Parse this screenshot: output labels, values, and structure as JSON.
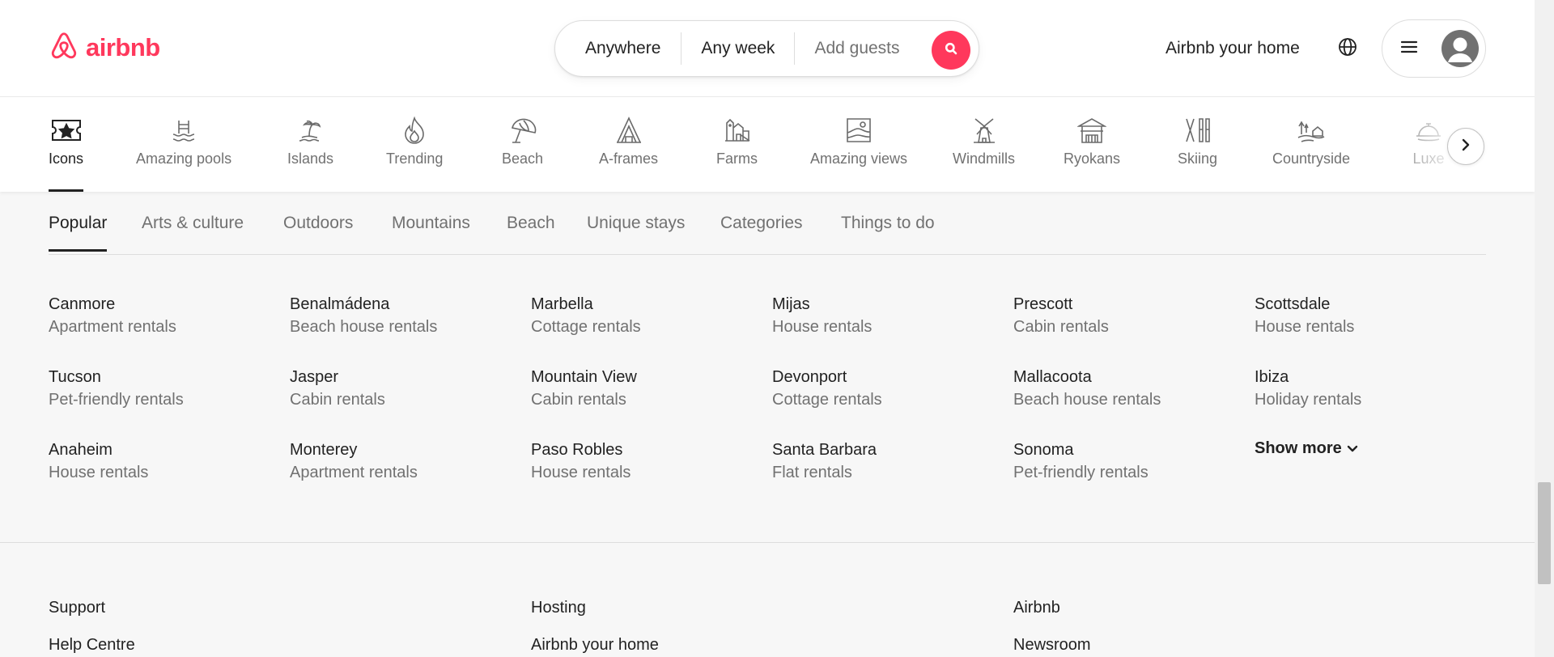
{
  "brand": {
    "name": "airbnb",
    "color": "#ff385c",
    "logo_icon": "airbnb-belo-icon"
  },
  "search": {
    "where": "Anywhere",
    "when": "Any week",
    "guests": "Add guests",
    "button_icon": "search-icon"
  },
  "header": {
    "host_link": "Airbnb your home",
    "globe_icon": "globe-icon",
    "menu_icon": "hamburger-menu-icon",
    "avatar_icon": "user-avatar-icon"
  },
  "categories": {
    "items": [
      {
        "label": "Icons",
        "icon": "ticket-star-icon",
        "active": true
      },
      {
        "label": "Amazing pools",
        "icon": "pool-icon"
      },
      {
        "label": "Islands",
        "icon": "island-palm-icon"
      },
      {
        "label": "Trending",
        "icon": "flame-icon"
      },
      {
        "label": "Beach",
        "icon": "beach-umbrella-icon"
      },
      {
        "label": "A-frames",
        "icon": "a-frame-icon"
      },
      {
        "label": "Farms",
        "icon": "barn-icon"
      },
      {
        "label": "Amazing views",
        "icon": "picture-view-icon"
      },
      {
        "label": "Windmills",
        "icon": "windmill-icon"
      },
      {
        "label": "Ryokans",
        "icon": "ryokan-icon"
      },
      {
        "label": "Skiing",
        "icon": "skis-icon"
      },
      {
        "label": "Countryside",
        "icon": "countryside-icon"
      },
      {
        "label": "Luxe",
        "icon": "luxe-cloche-icon"
      }
    ],
    "next_icon": "chevron-right-icon"
  },
  "tabs": [
    "Popular",
    "Arts & culture",
    "Outdoors",
    "Mountains",
    "Beach",
    "Unique stays",
    "Categories",
    "Things to do"
  ],
  "destinations": [
    {
      "city": "Canmore",
      "type": "Apartment rentals"
    },
    {
      "city": "Benalmádena",
      "type": "Beach house rentals"
    },
    {
      "city": "Marbella",
      "type": "Cottage rentals"
    },
    {
      "city": "Mijas",
      "type": "House rentals"
    },
    {
      "city": "Prescott",
      "type": "Cabin rentals"
    },
    {
      "city": "Scottsdale",
      "type": "House rentals"
    },
    {
      "city": "Tucson",
      "type": "Pet-friendly rentals"
    },
    {
      "city": "Jasper",
      "type": "Cabin rentals"
    },
    {
      "city": "Mountain View",
      "type": "Cabin rentals"
    },
    {
      "city": "Devonport",
      "type": "Cottage rentals"
    },
    {
      "city": "Mallacoota",
      "type": "Beach house rentals"
    },
    {
      "city": "Ibiza",
      "type": "Holiday rentals"
    },
    {
      "city": "Anaheim",
      "type": "House rentals"
    },
    {
      "city": "Monterey",
      "type": "Apartment rentals"
    },
    {
      "city": "Paso Robles",
      "type": "House rentals"
    },
    {
      "city": "Santa Barbara",
      "type": "Flat rentals"
    },
    {
      "city": "Sonoma",
      "type": "Pet-friendly rentals"
    }
  ],
  "show_more": {
    "label": "Show more",
    "icon": "chevron-down-icon"
  },
  "footer": {
    "columns": [
      {
        "heading": "Support",
        "link": "Help Centre"
      },
      {
        "heading": "Hosting",
        "link": "Airbnb your home"
      },
      {
        "heading": "Airbnb",
        "link": "Newsroom"
      }
    ]
  },
  "colors": {
    "text": "#222222",
    "muted": "#717171",
    "border": "#dddddd",
    "background": "#f7f7f7"
  }
}
